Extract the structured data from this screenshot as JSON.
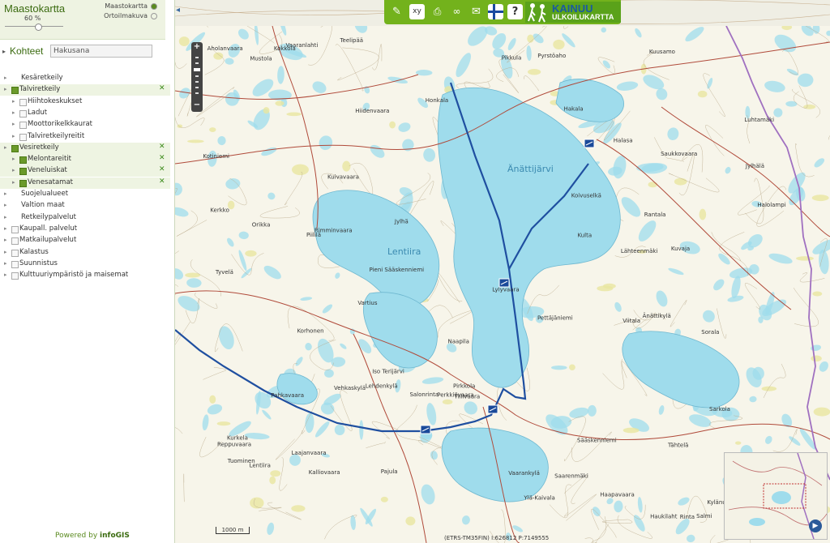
{
  "layer_switcher": {
    "base_title": "Maastokartta",
    "opacity": "60 %",
    "opacity_level": 0.6,
    "options": [
      {
        "label": "Maastokartta",
        "selected": true
      },
      {
        "label": "Ortoilmakuva",
        "selected": false
      }
    ]
  },
  "kohteet": {
    "label": "Kohteet",
    "search_value": "Hakusana"
  },
  "tree": [
    {
      "label": "Kesäretkeily",
      "level": 0,
      "checkbox": false,
      "checked": false,
      "remove": false
    },
    {
      "label": "Talviretkeily",
      "level": 0,
      "checkbox": true,
      "checked": true,
      "remove": true
    },
    {
      "label": "Hiihtokeskukset",
      "level": 1,
      "checkbox": true,
      "checked": false,
      "remove": false
    },
    {
      "label": "Ladut",
      "level": 1,
      "checkbox": true,
      "checked": false,
      "remove": false
    },
    {
      "label": "Moottorikelkkaurat",
      "level": 1,
      "checkbox": true,
      "checked": false,
      "remove": false
    },
    {
      "label": "Talviretkeilyreitit",
      "level": 1,
      "checkbox": true,
      "checked": false,
      "remove": false
    },
    {
      "label": "Vesiretkeily",
      "level": 0,
      "checkbox": true,
      "checked": true,
      "remove": true
    },
    {
      "label": "Melontareitit",
      "level": 1,
      "checkbox": true,
      "checked": true,
      "remove": true
    },
    {
      "label": "Veneluiskat",
      "level": 1,
      "checkbox": true,
      "checked": true,
      "remove": true
    },
    {
      "label": "Venesatamat",
      "level": 1,
      "checkbox": true,
      "checked": true,
      "remove": true
    },
    {
      "label": "Suojelualueet",
      "level": 0,
      "checkbox": false,
      "checked": false,
      "remove": false
    },
    {
      "label": "Valtion maat",
      "level": 0,
      "checkbox": false,
      "checked": false,
      "remove": false
    },
    {
      "label": "Retkeilypalvelut",
      "level": 0,
      "checkbox": false,
      "checked": false,
      "remove": false
    },
    {
      "label": "Kaupall. palvelut",
      "level": 0,
      "checkbox": true,
      "checked": false,
      "remove": false
    },
    {
      "label": "Matkailupalvelut",
      "level": 0,
      "checkbox": true,
      "checked": false,
      "remove": false
    },
    {
      "label": "Kalastus",
      "level": 0,
      "checkbox": true,
      "checked": false,
      "remove": false
    },
    {
      "label": "Suunnistus",
      "level": 0,
      "checkbox": true,
      "checked": false,
      "remove": false
    },
    {
      "label": "Kulttuuriympäristö ja maisemat",
      "level": 0,
      "checkbox": true,
      "checked": false,
      "remove": false
    }
  ],
  "remove_icon": "✕",
  "powered": {
    "prefix": "Powered by",
    "brand": "infoGIS"
  },
  "toolbar": {
    "icons": [
      "pencil-icon",
      "xy-coordinate-icon",
      "print-icon",
      "link-icon",
      "mail-icon",
      "finnish-flag-icon",
      "help-icon"
    ],
    "xy_label": "xy",
    "help_label": "?",
    "brand_line1": "KAINUU",
    "brand_line2": "ULKOILUKARTTA"
  },
  "map": {
    "scale_label": "1000 m",
    "coordinates": "(ETRS-TM35FIN) I:626812 P:7149555",
    "lakes": [
      {
        "name": "Änättijärvi"
      },
      {
        "name": "Lentiira"
      }
    ],
    "places": [
      "Naapila",
      "Piililä",
      "Kokkola",
      "Änättikylä",
      "Salmi",
      "Hiidenvaara",
      "Perkkiövaara",
      "Vartius",
      "Lehdenkylä",
      "Lähteenmäki",
      "Kuvaja",
      "Pikkula",
      "Aholanvaara",
      "Haukilaht",
      "Pieni Sääskenniemi",
      "Sääskenniemi",
      "Lylyvaara",
      "Halolampi",
      "Luhtamäki",
      "Jylhä",
      "Rinta",
      "Rimminvaara",
      "Saarenmäki",
      "Vehkaskylä",
      "Tähtelä",
      "Kulta",
      "Vaarankylä",
      "Kurkela",
      "Saukkovaara",
      "Reppuvaara",
      "Iso Terijärvi",
      "Salonrinta",
      "Lentiira",
      "Sarkola",
      "Halasa",
      "Kerkko",
      "Orikka",
      "Vaaranlahti",
      "Korhonen",
      "Pajula",
      "Tyvelä",
      "Kylänurmi",
      "Sorala",
      "Haapavaara",
      "Tiilivaara",
      "Tuominen",
      "Pirkkola",
      "Kuivavaara",
      "Teelipää",
      "Hakala",
      "Ylä-Kaivala",
      "Rantala",
      "Pettäjäniemi",
      "Kuusamo",
      "Jylhälä",
      "Koivuselkä",
      "Kalliovaara",
      "Mustola",
      "Pahkavaara",
      "Laajanvaara",
      "Pyrstöaho",
      "Honkala",
      "Kotiniemi",
      "Viitala"
    ],
    "harbor_markers": 4
  },
  "colors": {
    "accent": "#73b21c",
    "brand_blue": "#1a5aa0",
    "lake": "#9fdcec",
    "route": "#1f4fa0",
    "border": "#a070c0"
  }
}
